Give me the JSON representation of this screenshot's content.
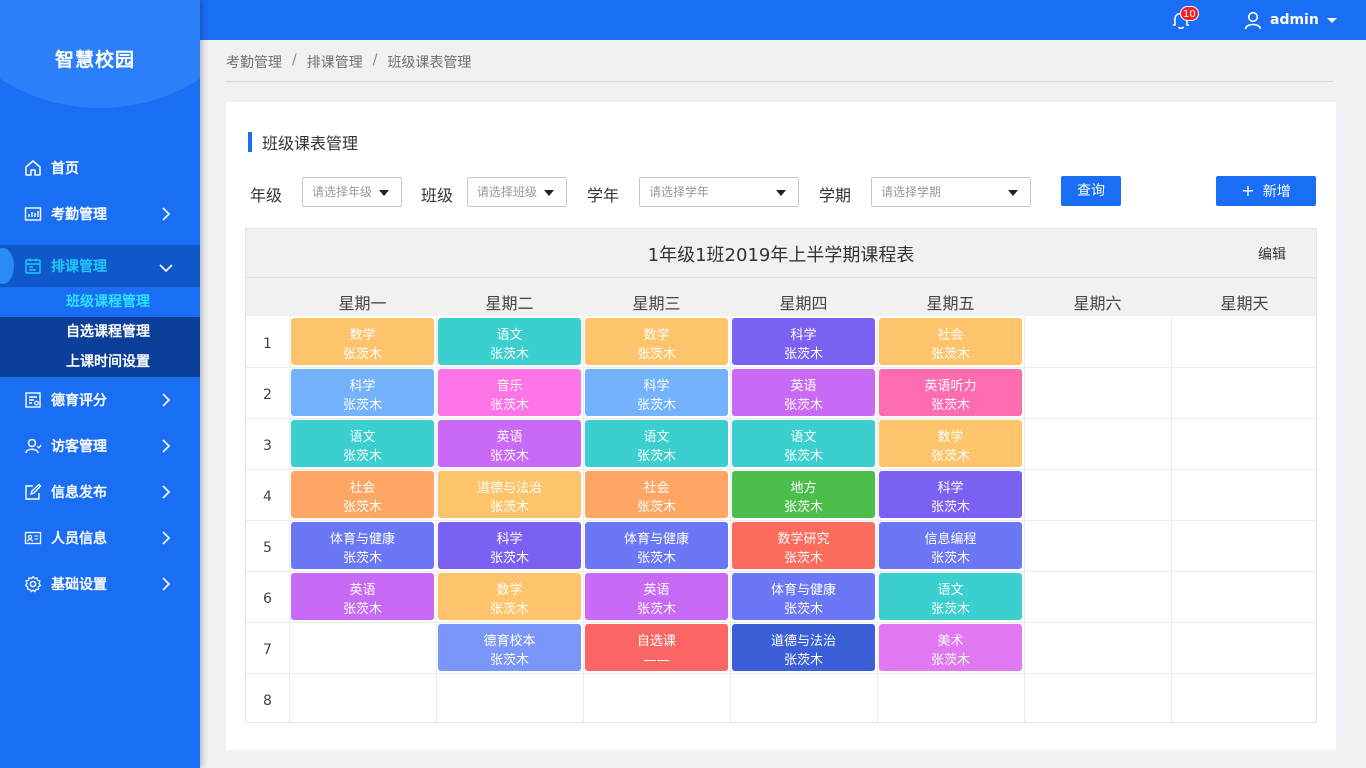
{
  "app": {
    "logo": "智慧校园"
  },
  "topbar": {
    "notification_count": "10",
    "username": "admin"
  },
  "sidebar": {
    "items": [
      {
        "label": "首页",
        "icon": "home-icon"
      },
      {
        "label": "考勤管理",
        "icon": "chart-icon"
      },
      {
        "label": "排课管理",
        "icon": "calendar-icon",
        "active": true
      },
      {
        "label": "德育评分",
        "icon": "score-icon"
      },
      {
        "label": "访客管理",
        "icon": "visitor-icon"
      },
      {
        "label": "信息发布",
        "icon": "edit-icon"
      },
      {
        "label": "人员信息",
        "icon": "idcard-icon"
      },
      {
        "label": "基础设置",
        "icon": "gear-icon"
      }
    ],
    "submenu": [
      "班级课程管理",
      "自选课程管理",
      "上课时间设置"
    ]
  },
  "breadcrumb": [
    "考勤管理",
    "排课管理",
    "班级课表管理"
  ],
  "section_title": "班级课表管理",
  "filters": {
    "grade_label": "年级",
    "grade_placeholder": "请选择年级",
    "class_label": "班级",
    "class_placeholder": "请选择班级",
    "year_label": "学年",
    "year_placeholder": "请选择学年",
    "term_label": "学期",
    "term_placeholder": "请选择学期",
    "query_button": "查询",
    "add_button": "新增"
  },
  "timetable": {
    "title": "1年级1班2019年上半学期课程表",
    "edit_label": "编辑",
    "days": [
      "星期一",
      "星期二",
      "星期三",
      "星期四",
      "星期五",
      "星期六",
      "星期天"
    ],
    "periods": [
      "1",
      "2",
      "3",
      "4",
      "5",
      "6",
      "7",
      "8"
    ],
    "colors": {
      "orange": "#fdc46c",
      "teal": "#3ccfcf",
      "purple": "#7b61f2",
      "blue_light": "#74b3fb",
      "pink": "#fd74e6",
      "violet": "#c86af5",
      "rose": "#fd6cb0",
      "salmon": "#fea765",
      "green": "#4bbe4b",
      "indigo": "#6a78f6",
      "red": "#fb6c5c",
      "coral": "#fa6666",
      "navy": "#3b5fd6",
      "periwinkle": "#7a96f8",
      "lilac": "#e079f1"
    },
    "rows": [
      [
        {
          "subject": "数学",
          "teacher": "张茨木",
          "color": "orange"
        },
        {
          "subject": "语文",
          "teacher": "张茨木",
          "color": "teal"
        },
        {
          "subject": "数学",
          "teacher": "张茨木",
          "color": "orange"
        },
        {
          "subject": "科学",
          "teacher": "张茨木",
          "color": "purple"
        },
        {
          "subject": "社会",
          "teacher": "张茨木",
          "color": "orange"
        },
        null,
        null
      ],
      [
        {
          "subject": "科学",
          "teacher": "张茨木",
          "color": "blue_light"
        },
        {
          "subject": "音乐",
          "teacher": "张茨木",
          "color": "pink"
        },
        {
          "subject": "科学",
          "teacher": "张茨木",
          "color": "blue_light"
        },
        {
          "subject": "英语",
          "teacher": "张茨木",
          "color": "violet"
        },
        {
          "subject": "英语听力",
          "teacher": "张茨木",
          "color": "rose"
        },
        null,
        null
      ],
      [
        {
          "subject": "语文",
          "teacher": "张茨木",
          "color": "teal"
        },
        {
          "subject": "英语",
          "teacher": "张茨木",
          "color": "violet"
        },
        {
          "subject": "语文",
          "teacher": "张茨木",
          "color": "teal"
        },
        {
          "subject": "语文",
          "teacher": "张茨木",
          "color": "teal"
        },
        {
          "subject": "数学",
          "teacher": "张茨木",
          "color": "orange"
        },
        null,
        null
      ],
      [
        {
          "subject": "社会",
          "teacher": "张茨木",
          "color": "salmon"
        },
        {
          "subject": "道德与法治",
          "teacher": "张茨木",
          "color": "orange"
        },
        {
          "subject": "社会",
          "teacher": "张茨木",
          "color": "salmon"
        },
        {
          "subject": "地方",
          "teacher": "张茨木",
          "color": "green"
        },
        {
          "subject": "科学",
          "teacher": "张茨木",
          "color": "purple"
        },
        null,
        null
      ],
      [
        {
          "subject": "体育与健康",
          "teacher": "张茨木",
          "color": "indigo"
        },
        {
          "subject": "科学",
          "teacher": "张茨木",
          "color": "purple"
        },
        {
          "subject": "体育与健康",
          "teacher": "张茨木",
          "color": "indigo"
        },
        {
          "subject": "数学研究",
          "teacher": "张茨木",
          "color": "red"
        },
        {
          "subject": "信息编程",
          "teacher": "张茨木",
          "color": "indigo"
        },
        null,
        null
      ],
      [
        {
          "subject": "英语",
          "teacher": "张茨木",
          "color": "violet"
        },
        {
          "subject": "数学",
          "teacher": "张茨木",
          "color": "orange"
        },
        {
          "subject": "英语",
          "teacher": "张茨木",
          "color": "violet"
        },
        {
          "subject": "体育与健康",
          "teacher": "张茨木",
          "color": "indigo"
        },
        {
          "subject": "语文",
          "teacher": "张茨木",
          "color": "teal"
        },
        null,
        null
      ],
      [
        null,
        {
          "subject": "德育校本",
          "teacher": "张茨木",
          "color": "periwinkle"
        },
        {
          "subject": "自选课",
          "teacher": "——",
          "color": "coral"
        },
        {
          "subject": "道德与法治",
          "teacher": "张茨木",
          "color": "navy"
        },
        {
          "subject": "美术",
          "teacher": "张茨木",
          "color": "lilac"
        },
        null,
        null
      ],
      [
        null,
        null,
        null,
        null,
        null,
        null,
        null
      ]
    ]
  }
}
